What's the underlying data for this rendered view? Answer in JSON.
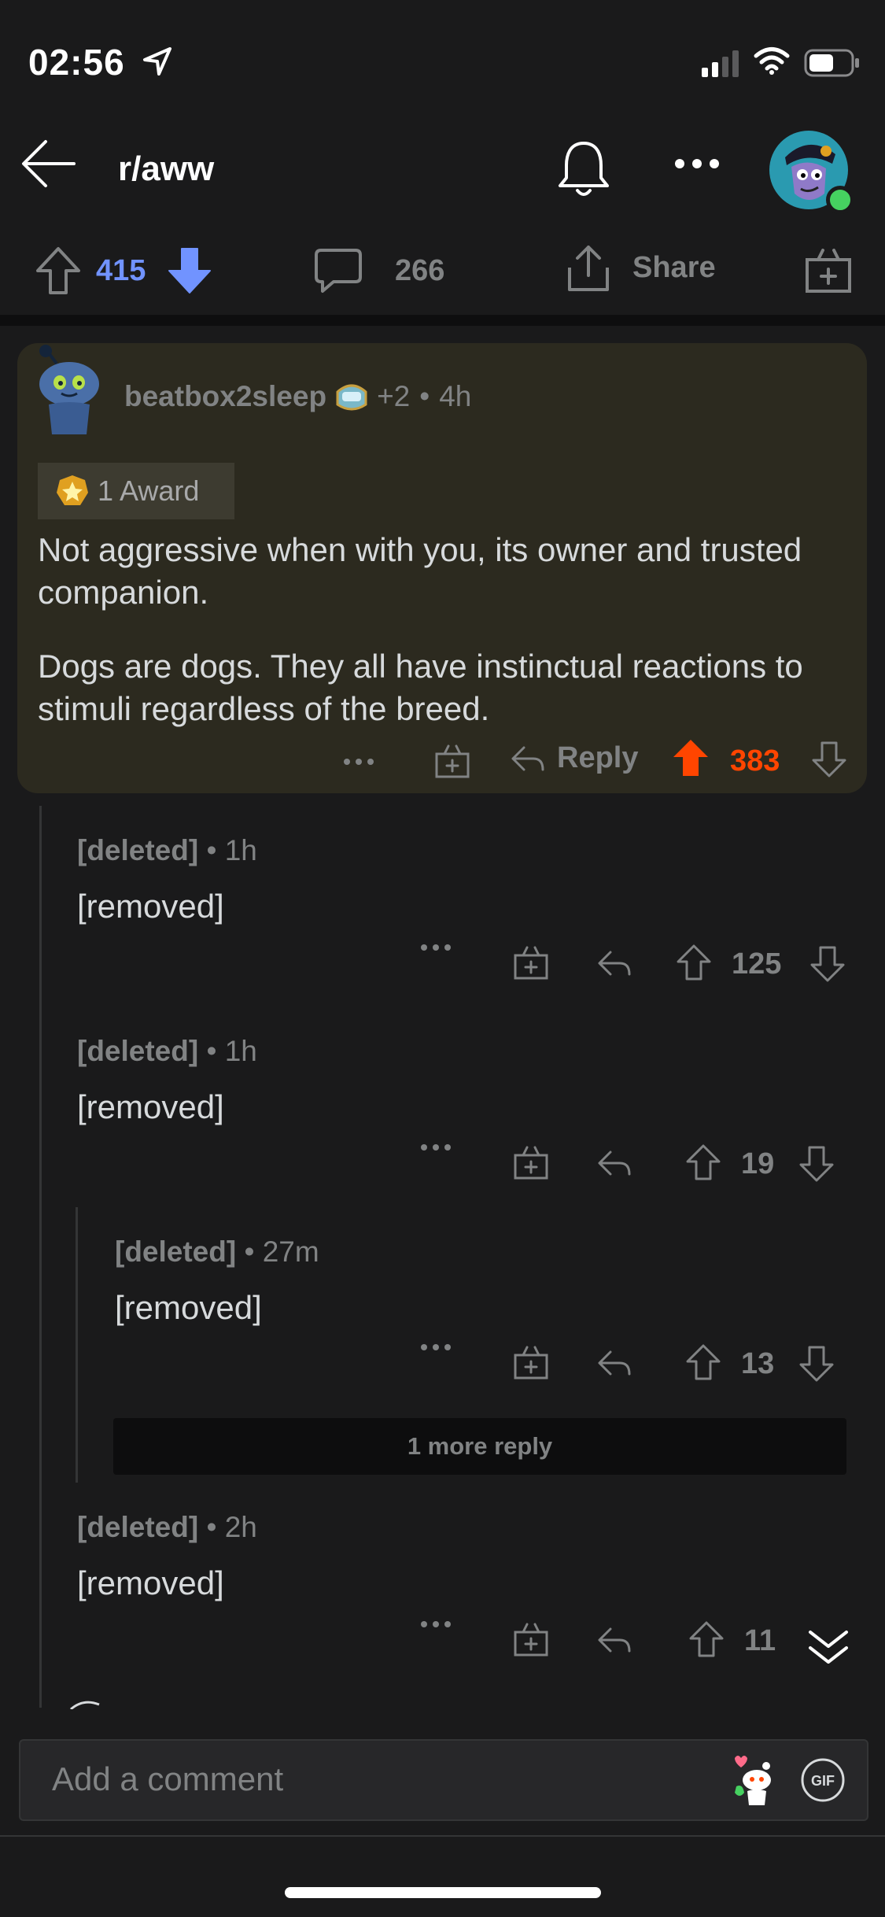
{
  "status": {
    "time": "02:56"
  },
  "header": {
    "subreddit": "r/aww"
  },
  "post_bar": {
    "votes": "415",
    "comments": "266",
    "share_label": "Share"
  },
  "top_comment": {
    "author": "beatbox2sleep",
    "flair_extra": "+2",
    "separator": "•",
    "age": "4h",
    "awards": "1 Award",
    "paragraphs": [
      "Not aggressive when with you, its owner and trusted companion.",
      "Dogs are dogs. They all have instinctual reactions to stimuli regardless of the breed."
    ],
    "reply_label": "Reply",
    "score": "383"
  },
  "children": [
    {
      "author": "[deleted]",
      "age": "1h",
      "body": "[removed]",
      "score": "125"
    },
    {
      "author": "[deleted]",
      "age": "1h",
      "body": "[removed]",
      "score": "19"
    },
    {
      "author": "[deleted]",
      "age": "27m",
      "body": "[removed]",
      "score": "13"
    },
    {
      "author": "[deleted]",
      "age": "2h",
      "body": "[removed]",
      "score": "11"
    }
  ],
  "more_replies": "1 more reply",
  "comment_input": {
    "placeholder": "Add a comment"
  },
  "colors": {
    "upvote": "#ff4500",
    "downvote": "#7193ff",
    "online": "#46d160",
    "highlight": "#2c2a1f"
  }
}
